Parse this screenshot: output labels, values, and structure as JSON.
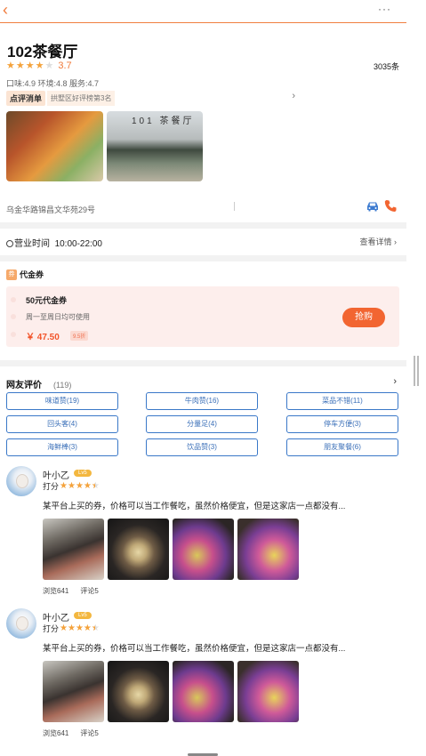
{
  "topbar": {
    "back_icon": "‹",
    "more_icon": "···"
  },
  "shop": {
    "name": "102茶餐厅",
    "stars": 3.5,
    "score": "3.7",
    "review_count": "3035条",
    "subscores": "口味:4.9 环境:4.8 服务:4.7",
    "rank_badge": "点评消单",
    "rank_text": "拱墅区好评榜第3名",
    "store_sign": "101 茶餐厅",
    "address": "乌金华路锦昌文华苑29号"
  },
  "hours": {
    "label": "营业时间",
    "value": "10:00-22:00",
    "more": "查看详情 ›"
  },
  "voucher": {
    "tag": "券",
    "section_title": "代金券",
    "name": "50元代金券",
    "desc": "周一至周日均可使用",
    "price": "￥ 47.50",
    "discount": "9.5折",
    "buy_label": "抢购"
  },
  "reviews": {
    "title": "网友评价",
    "count": "(119)",
    "arrow": "›",
    "tags": [
      "味道赞(19)",
      "牛肉赞(16)",
      "菜品不错(11)",
      "回头客(4)",
      "分量足(4)",
      "停车方便(3)",
      "海鲜棒(3)",
      "饮品赞(3)",
      "朋友聚餐(6)"
    ],
    "items": [
      {
        "user": "叶小乙",
        "level": "Lv5",
        "rate_label": "打分",
        "text": "某平台上买的券，价格可以当工作餐吃，虽然价格便宜，但是这家店一点都没有...",
        "views": "浏览641",
        "comments": "评论5"
      },
      {
        "user": "叶小乙",
        "level": "Lv5",
        "rate_label": "打分",
        "text": "某平台上买的券，价格可以当工作餐吃，虽然价格便宜，但是这家店一点都没有...",
        "views": "浏览641",
        "comments": "评论5"
      }
    ]
  },
  "colors": {
    "accent": "#f26531",
    "star": "#f4a23b",
    "tag_border": "#3a78c8"
  }
}
